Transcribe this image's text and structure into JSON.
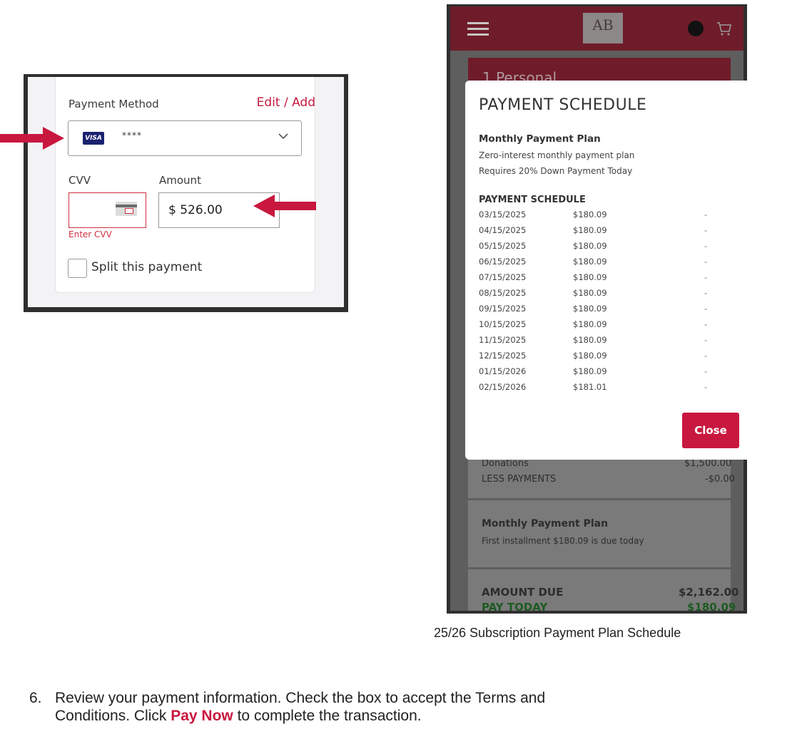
{
  "left_form": {
    "payment_method_label": "Payment Method",
    "edit_add_link": "Edit / Add",
    "card_brand": "VISA",
    "card_masked": "****",
    "cvv_label": "CVV",
    "amount_label": "Amount",
    "cvv_error": "Enter CVV",
    "amount_value": "$ 526.00",
    "split_label": "Split this payment"
  },
  "phone": {
    "bg_step": "1  Personal",
    "bg_rows": {
      "donations_label": "Donations",
      "donations_value": "$1,500.00",
      "less_payments_label": "LESS PAYMENTS",
      "less_payments_value": "-$0.00",
      "plan_title": "Monthly Payment Plan",
      "plan_note": "First installment $180.09 is due today",
      "amount_due_label": "AMOUNT DUE",
      "amount_due_value": "$2,162.00",
      "pay_today_label": "PAY TODAY",
      "pay_today_value": "$180.09"
    },
    "modal": {
      "title": "PAYMENT SCHEDULE",
      "plan_name": "Monthly Payment Plan",
      "plan_desc1": "Zero-interest monthly payment plan",
      "plan_desc2": "Requires 20% Down Payment Today",
      "schedule_heading": "PAYMENT SCHEDULE",
      "schedule": [
        {
          "date": "03/15/2025",
          "amount": "$180.09",
          "status": "-"
        },
        {
          "date": "04/15/2025",
          "amount": "$180.09",
          "status": "-"
        },
        {
          "date": "05/15/2025",
          "amount": "$180.09",
          "status": "-"
        },
        {
          "date": "06/15/2025",
          "amount": "$180.09",
          "status": "-"
        },
        {
          "date": "07/15/2025",
          "amount": "$180.09",
          "status": "-"
        },
        {
          "date": "08/15/2025",
          "amount": "$180.09",
          "status": "-"
        },
        {
          "date": "09/15/2025",
          "amount": "$180.09",
          "status": "-"
        },
        {
          "date": "10/15/2025",
          "amount": "$180.09",
          "status": "-"
        },
        {
          "date": "11/15/2025",
          "amount": "$180.09",
          "status": "-"
        },
        {
          "date": "12/15/2025",
          "amount": "$180.09",
          "status": "-"
        },
        {
          "date": "01/15/2026",
          "amount": "$180.09",
          "status": "-"
        },
        {
          "date": "02/15/2026",
          "amount": "$181.01",
          "status": "-"
        }
      ],
      "close_label": "Close"
    }
  },
  "caption": "25/26 Subscription Payment Plan Schedule",
  "step6": {
    "number": "6.",
    "line1": "Review your payment information. Check the box to accept the Terms and",
    "line2_before": "Conditions. Click ",
    "line2_bold": "Pay Now",
    "line2_after": " to complete the transaction."
  },
  "colors": {
    "accent": "#c8183f",
    "header": "#6f1c2a"
  },
  "icons": [
    "menu-icon",
    "cart-icon",
    "chevron-down-icon",
    "credit-card-icon",
    "arrow-right-icon",
    "arrow-left-icon"
  ]
}
